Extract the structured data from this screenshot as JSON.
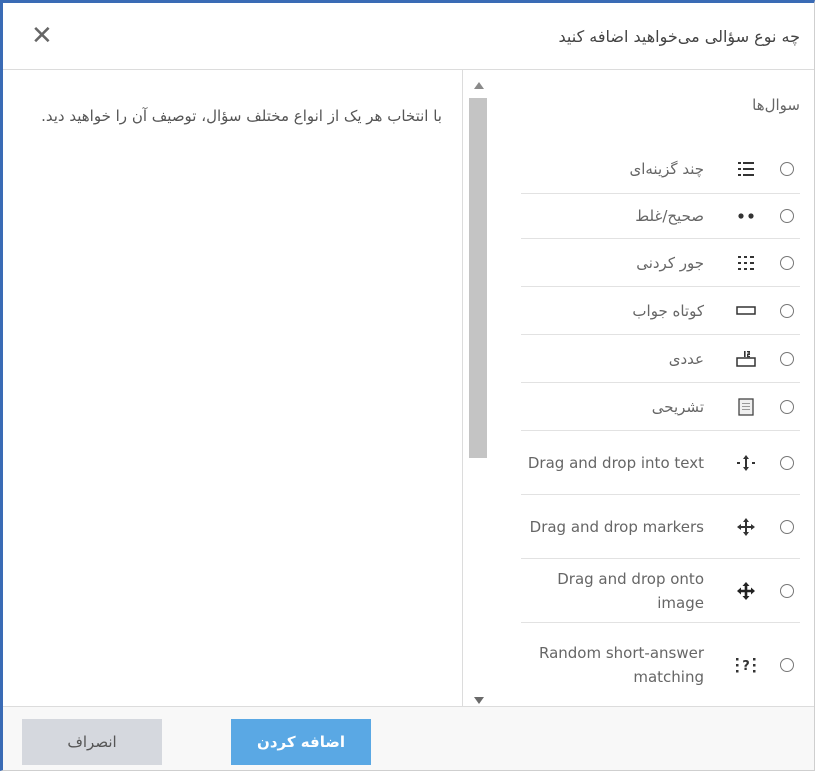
{
  "dialog": {
    "title": "چه نوع سؤالی می‌خواهید اضافه کنید",
    "close_icon": "close-icon"
  },
  "description": {
    "text": "با انتخاب هر یک از انواع مختلف سؤال، توصیف آن را خواهید دید."
  },
  "list": {
    "section_label": "سوال‌ها",
    "items": [
      {
        "label": "چند گزینه‌ای",
        "icon": "multichoice-icon",
        "rtl": true
      },
      {
        "label": "صحیح/غلط",
        "icon": "truefalse-icon",
        "rtl": true
      },
      {
        "label": "جور کردنی",
        "icon": "matching-icon",
        "rtl": true
      },
      {
        "label": "کوتاه جواب",
        "icon": "shortanswer-icon",
        "rtl": true
      },
      {
        "label": "عددی",
        "icon": "numerical-icon",
        "rtl": true
      },
      {
        "label": "تشریحی",
        "icon": "essay-icon",
        "rtl": true
      },
      {
        "label": "Drag and drop into text",
        "icon": "ddwtos-icon",
        "rtl": false
      },
      {
        "label": "Drag and drop markers",
        "icon": "ddmarker-icon",
        "rtl": false
      },
      {
        "label": "Drag and drop onto image",
        "icon": "ddimageortext-icon",
        "rtl": false
      },
      {
        "label": "Random short-answer matching",
        "icon": "randomsamatch-icon",
        "rtl": false
      }
    ]
  },
  "footer": {
    "add_label": "اضافه کردن",
    "cancel_label": "انصراف"
  },
  "colors": {
    "accent": "#3a6bb5",
    "primary_button": "#5aa8e4",
    "secondary_button": "#d5d8de"
  }
}
